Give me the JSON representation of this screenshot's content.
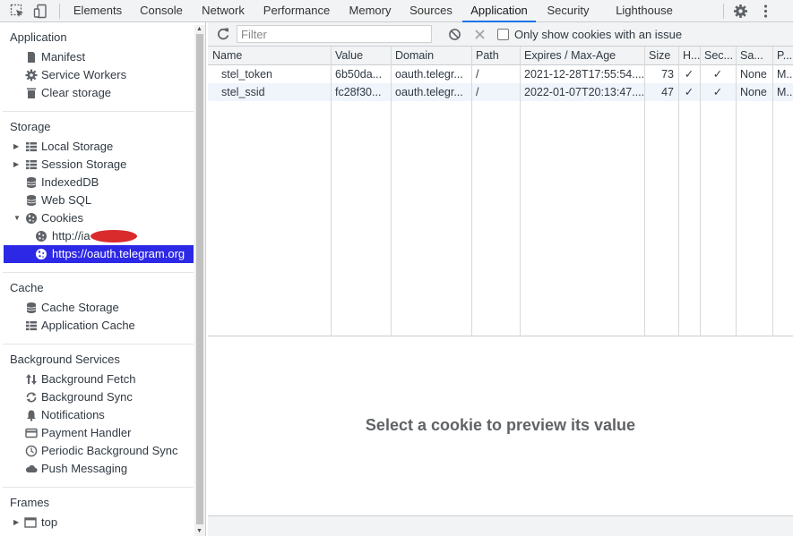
{
  "toolbar_top": {
    "tabs": [
      "Elements",
      "Console",
      "Network",
      "Performance",
      "Memory",
      "Sources",
      "Application",
      "Security",
      "Lighthouse"
    ],
    "active_tab": "Application",
    "icons": [
      "inspect-element-icon",
      "device-toolbar-icon",
      "settings-gear-icon",
      "more-vertical-icon"
    ]
  },
  "sidebar": {
    "application": {
      "title": "Application",
      "items": [
        {
          "label": "Manifest",
          "icon": "document-icon"
        },
        {
          "label": "Service Workers",
          "icon": "gear-icon"
        },
        {
          "label": "Clear storage",
          "icon": "trash-icon"
        }
      ]
    },
    "storage": {
      "title": "Storage",
      "items": [
        {
          "label": "Local Storage",
          "icon": "grid-icon",
          "expandable": true
        },
        {
          "label": "Session Storage",
          "icon": "grid-icon",
          "expandable": true
        },
        {
          "label": "IndexedDB",
          "icon": "database-icon"
        },
        {
          "label": "Web SQL",
          "icon": "database-icon"
        },
        {
          "label": "Cookies",
          "icon": "cookie-icon",
          "expanded": true
        }
      ],
      "cookie_origins": [
        {
          "label": "http://ia",
          "redacted": true
        },
        {
          "label": "https://oauth.telegram.org",
          "selected": true
        }
      ]
    },
    "cache": {
      "title": "Cache",
      "items": [
        {
          "label": "Cache Storage",
          "icon": "database-icon"
        },
        {
          "label": "Application Cache",
          "icon": "grid-icon"
        }
      ]
    },
    "background_services": {
      "title": "Background Services",
      "items": [
        {
          "label": "Background Fetch",
          "icon": "up-down-arrows-icon"
        },
        {
          "label": "Background Sync",
          "icon": "sync-icon"
        },
        {
          "label": "Notifications",
          "icon": "bell-icon"
        },
        {
          "label": "Payment Handler",
          "icon": "card-icon"
        },
        {
          "label": "Periodic Background Sync",
          "icon": "clock-icon"
        },
        {
          "label": "Push Messaging",
          "icon": "cloud-icon"
        }
      ]
    },
    "frames": {
      "title": "Frames",
      "items": [
        {
          "label": "top",
          "icon": "frame-icon",
          "expandable": true
        }
      ]
    }
  },
  "cookie_toolbar": {
    "filter_placeholder": "Filter",
    "only_issue_label": "Only show cookies with an issue",
    "only_issue_checked": false
  },
  "cookies_table": {
    "columns": [
      "Name",
      "Value",
      "Domain",
      "Path",
      "Expires / Max-Age",
      "Size",
      "H...",
      "Sec...",
      "Sa...",
      "P..."
    ],
    "rows": [
      {
        "name": "stel_token",
        "value": "6b50da...",
        "domain": "oauth.telegr...",
        "path": "/",
        "expires": "2021-12-28T17:55:54....",
        "size": "73",
        "httponly": "✓",
        "secure": "✓",
        "samesite": "None",
        "priority": "M..."
      },
      {
        "name": "stel_ssid",
        "value": "fc28f30...",
        "domain": "oauth.telegr...",
        "path": "/",
        "expires": "2022-01-07T20:13:47....",
        "size": "47",
        "httponly": "✓",
        "secure": "✓",
        "samesite": "None",
        "priority": "M..."
      }
    ]
  },
  "preview": {
    "message": "Select a cookie to preview its value"
  },
  "colors": {
    "accent": "#1a73e8",
    "selection": "#2d28e6",
    "redaction": "#d92b2b"
  }
}
